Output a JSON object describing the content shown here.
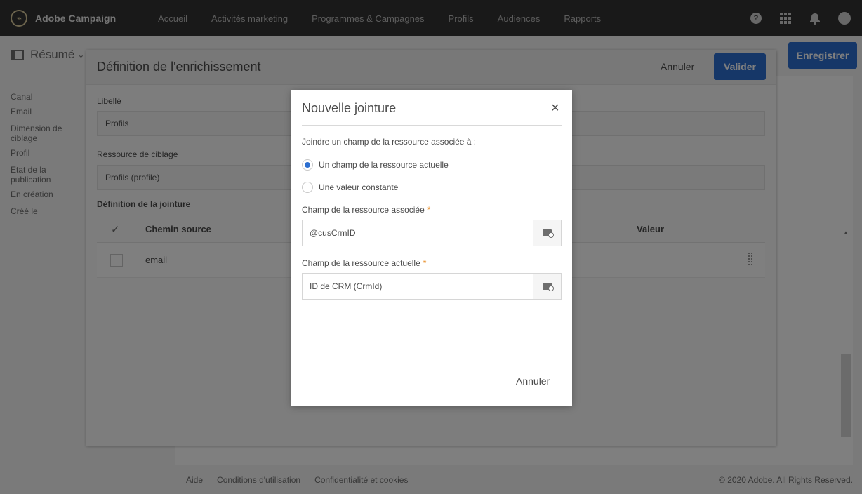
{
  "app": {
    "logo_text": "Adobe Campaign",
    "nav": [
      "Accueil",
      "Activités marketing",
      "Programmes & Campagnes",
      "Profils",
      "Audiences",
      "Rapports"
    ],
    "help_glyph": "?"
  },
  "page": {
    "summary_label": "Résumé",
    "save_label": "Enregistrer",
    "left_panel": [
      {
        "label": "Canal",
        "value": "Email"
      },
      {
        "label": "Dimension de ciblage",
        "value": "Profil"
      },
      {
        "label": "Etat de la publication",
        "value": "En création"
      },
      {
        "label": "Créé le",
        "value": ""
      }
    ],
    "footer": {
      "links": [
        "Aide",
        "Conditions d'utilisation",
        "Confidentialité et cookies"
      ],
      "copyright": "© 2020 Adobe. All Rights Reserved."
    }
  },
  "enrichment": {
    "title": "Définition de l'enrichissement",
    "cancel_label": "Annuler",
    "validate_label": "Valider",
    "libelle_label": "Libellé",
    "libelle_value": "Profils",
    "resource_label": "Ressource de ciblage",
    "resource_value": "Profils (profile)",
    "join_title": "Définition de la jointure",
    "table": {
      "col_source": "Chemin source",
      "col_value": "Valeur",
      "rows": [
        {
          "source": "email"
        }
      ]
    }
  },
  "modal": {
    "title": "Nouvelle jointure",
    "close_glyph": "×",
    "intro": "Joindre un champ de la ressource associée à :",
    "options": [
      {
        "label": "Un champ de la ressource actuelle",
        "selected": true
      },
      {
        "label": "Une valeur constante",
        "selected": false
      }
    ],
    "field1_label": "Champ de la ressource associée",
    "field1_value": "@cusCrmID",
    "field2_label": "Champ de la ressource actuelle",
    "field2_value": "ID de CRM (CrmId)",
    "required_mark": "*",
    "cancel_label": "Annuler"
  },
  "colors": {
    "accent": "#2d6fd0",
    "topbar": "#323232",
    "required": "#e68619"
  }
}
